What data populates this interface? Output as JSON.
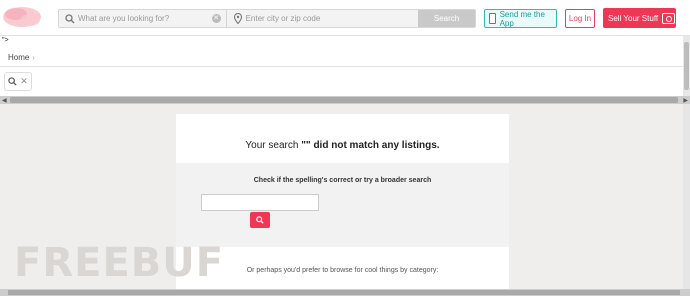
{
  "header": {
    "search_placeholder": "What are you looking for?",
    "location_placeholder": "Enter city or zip code",
    "search_button": "Search",
    "app_button": "Send me the App",
    "login_button": "Log In",
    "sell_button": "Sell Your Stuff"
  },
  "stray_text": "\">",
  "breadcrumb": {
    "home": "Home",
    "separator": "›"
  },
  "results": {
    "message_prefix": "Your search ",
    "message_query": "\"\" did not match any listings.",
    "hint": "Check if the spelling's correct or try a broader search",
    "browse_text": "Or perhaps you'd prefer to browse for cool things by category:"
  },
  "watermark": "FREEBUF",
  "colors": {
    "accent": "#ee3755",
    "teal": "#139e98",
    "page_bg": "#f0eeec"
  }
}
